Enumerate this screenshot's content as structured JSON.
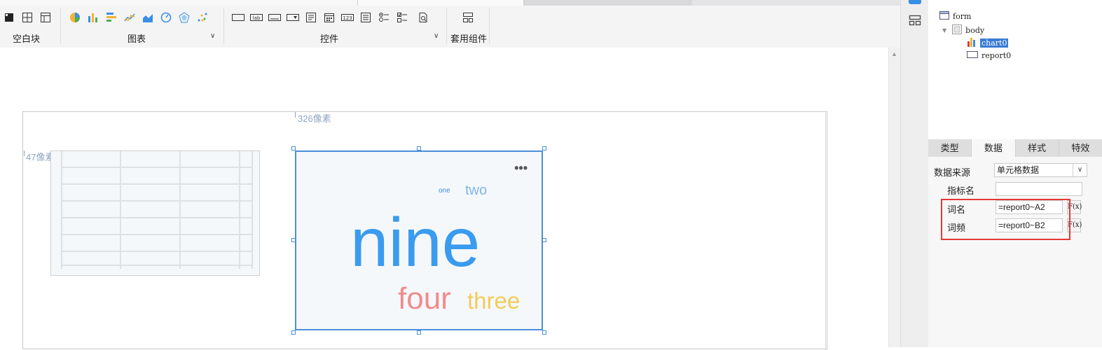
{
  "toolbar": {
    "groups": [
      {
        "label": "空白块",
        "icons": [
          "block-icon",
          "split-layout-icon",
          "grid-layout-icon"
        ]
      },
      {
        "label": "图表",
        "icons": [
          "pie-chart-icon",
          "bar-chart-icon",
          "horizontal-bar-icon",
          "line-chart-icon",
          "area-chart-icon",
          "gauge-icon",
          "radar-chart-icon",
          "scatter-chart-icon"
        ],
        "has_dropdown": true
      },
      {
        "label": "控件",
        "icons": [
          "textbox-icon",
          "label-icon",
          "button-icon",
          "combobox-icon",
          "list-icon",
          "date-icon",
          "number-icon",
          "text-area-icon",
          "radio-group-icon",
          "checkbox-group-icon",
          "file-preview-icon"
        ],
        "has_dropdown": true
      },
      {
        "label": "套用组件",
        "icons": [
          "template-icon"
        ]
      }
    ],
    "label_icon_text": "lab",
    "number_icon_text": "123"
  },
  "canvas": {
    "width_guide": "326像素",
    "height_guide": "47像素"
  },
  "wordcloud": {
    "words": [
      {
        "text": "one",
        "color": "#3a8ee6"
      },
      {
        "text": "two",
        "color": "#7fb8e6"
      },
      {
        "text": "nine",
        "color": "#3a9bef"
      },
      {
        "text": "four",
        "color": "#f08c8c"
      },
      {
        "text": "three",
        "color": "#f2cc5a"
      }
    ],
    "more": "•••"
  },
  "tree": {
    "nodes": [
      {
        "label": "form",
        "icon": "form-icon"
      },
      {
        "label": "body",
        "icon": "body-icon"
      },
      {
        "label": "chart0",
        "icon": "chart-node-icon",
        "selected": true
      },
      {
        "label": "report0",
        "icon": "report-node-icon"
      }
    ]
  },
  "panel": {
    "tabs": [
      "类型",
      "数据",
      "样式",
      "特效"
    ],
    "active_tab": "数据",
    "data_source_label": "数据来源",
    "data_source_value": "单元格数据",
    "metric_label": "指标名",
    "metric_value": "",
    "word_label": "词名",
    "word_value": "=report0~A2",
    "freq_label": "词频",
    "freq_value": "=report0~B2",
    "fx_text": "F(x)"
  },
  "colors": {
    "accent": "#3a8ee6",
    "selection_border": "#4a90d9",
    "highlight": "#e53935"
  }
}
